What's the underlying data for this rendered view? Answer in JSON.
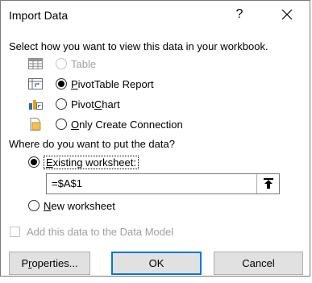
{
  "dialog": {
    "title": "Import Data",
    "help_label": "?",
    "view_prompt": "Select how you want to view this data in your workbook.",
    "view_options": [
      {
        "label": "Table",
        "mnemonic": "",
        "rest": "Table",
        "icon": "table-icon",
        "state": "disabled"
      },
      {
        "label": "PivotTable Report",
        "mnemonic": "P",
        "rest": "ivotTable Report",
        "icon": "pivottable-icon",
        "state": "selected"
      },
      {
        "label": "PivotChart",
        "pre": "Pivot",
        "mnemonic": "C",
        "rest": "hart",
        "icon": "pivotchart-icon",
        "state": "unselected"
      },
      {
        "label": "Only Create Connection",
        "mnemonic": "O",
        "rest": "nly Create Connection",
        "icon": "connection-icon",
        "state": "unselected"
      }
    ],
    "location_prompt": "Where do you want to put the data?",
    "location_options": [
      {
        "label": "Existing worksheet:",
        "mnemonic": "E",
        "rest": "xisting worksheet:",
        "state": "selected"
      },
      {
        "label": "New worksheet",
        "mnemonic": "N",
        "rest": "ew worksheet",
        "state": "unselected"
      }
    ],
    "range_value": "=$A$1",
    "data_model_label": "Add this data to the Data Model",
    "data_model_checked": false,
    "buttons": {
      "properties": {
        "label": "Properties...",
        "pre": "P",
        "mnemonic": "r",
        "rest": "operties..."
      },
      "ok": "OK",
      "cancel": "Cancel"
    }
  },
  "colors": {
    "default_button_border": "#0078d7",
    "button_face": "#e1e1e1",
    "disabled_text": "#a0a0a0"
  }
}
